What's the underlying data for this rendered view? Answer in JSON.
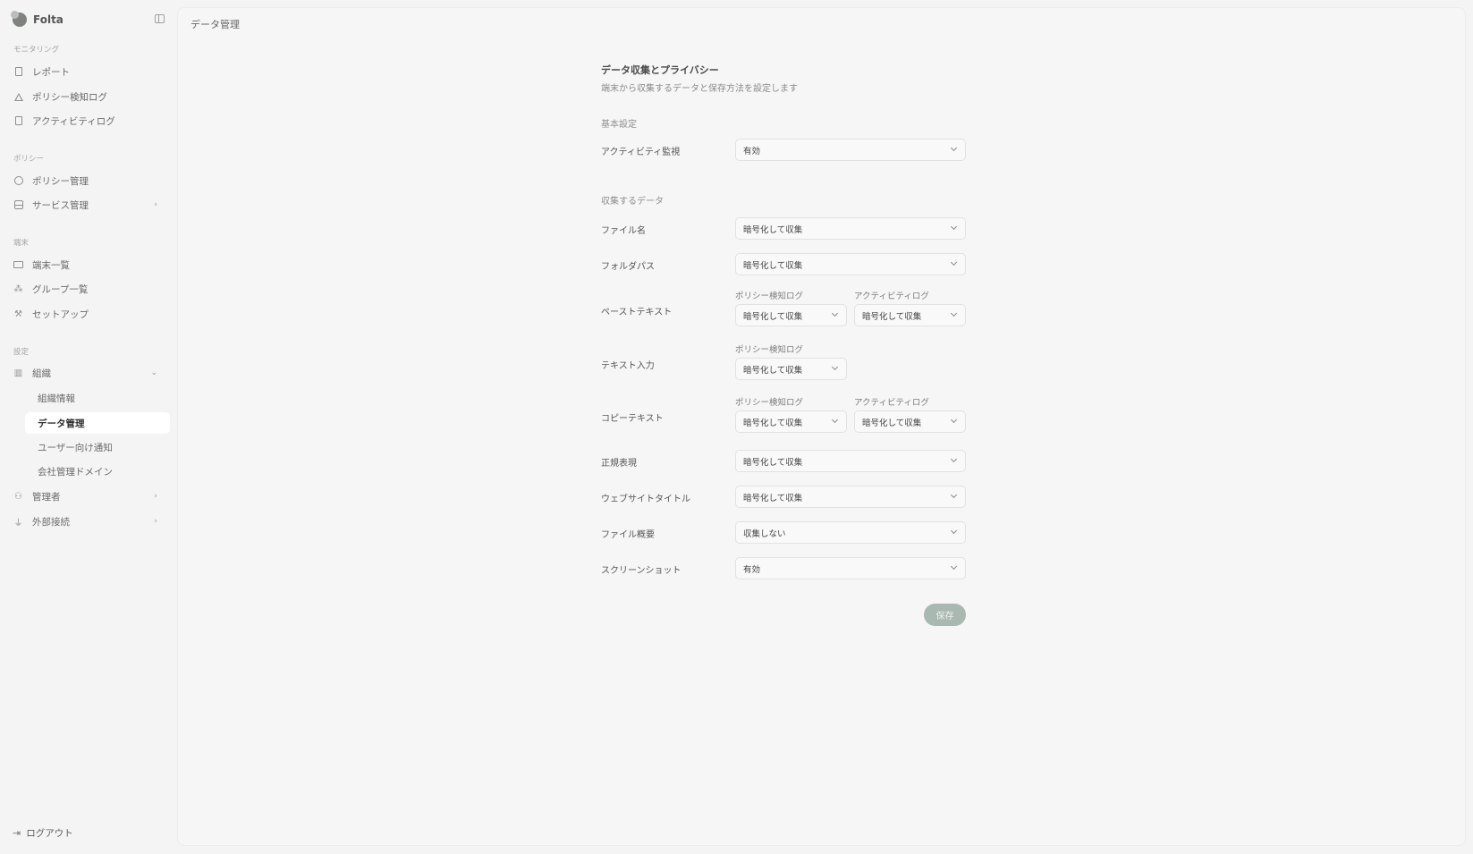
{
  "app": {
    "name": "Folta"
  },
  "sidebar": {
    "sections": [
      {
        "label": "モニタリング",
        "items": [
          "レポート",
          "ポリシー検知ログ",
          "アクティビティログ"
        ]
      },
      {
        "label": "ポリシー",
        "items": [
          "ポリシー管理",
          "サービス管理"
        ]
      },
      {
        "label": "端末",
        "items": [
          "端末一覧",
          "グループ一覧",
          "セットアップ"
        ]
      },
      {
        "label": "設定",
        "items": [
          "組織",
          "管理者",
          "外部接続"
        ]
      }
    ],
    "org_subitems": [
      "組織情報",
      "データ管理",
      "ユーザー向け通知",
      "会社管理ドメイン"
    ],
    "logout": "ログアウト"
  },
  "page": {
    "title": "データ管理"
  },
  "form": {
    "title": "データ収集とプライバシー",
    "subtitle": "端末から収集するデータと保存方法を設定します",
    "basic_label": "基本設定",
    "collect_label": "収集するデータ",
    "col_policy": "ポリシー検知ログ",
    "col_activity": "アクティビティログ",
    "rows": {
      "activity_monitor": {
        "label": "アクティビティ監視",
        "value": "有効"
      },
      "file_name": {
        "label": "ファイル名",
        "value": "暗号化して収集"
      },
      "folder_path": {
        "label": "フォルダパス",
        "value": "暗号化して収集"
      },
      "paste_text": {
        "label": "ペーストテキスト",
        "policy": "暗号化して収集",
        "activity": "暗号化して収集"
      },
      "text_input": {
        "label": "テキスト入力",
        "policy": "暗号化して収集"
      },
      "copy_text": {
        "label": "コピーテキスト",
        "policy": "暗号化して収集",
        "activity": "暗号化して収集"
      },
      "regex": {
        "label": "正規表現",
        "value": "暗号化して収集"
      },
      "website_title": {
        "label": "ウェブサイトタイトル",
        "value": "暗号化して収集"
      },
      "file_summary": {
        "label": "ファイル概要",
        "value": "収集しない"
      },
      "screenshot": {
        "label": "スクリーンショット",
        "value": "有効"
      }
    },
    "save": "保存"
  },
  "colors": {
    "accent": "#a9b8b1",
    "active_bg": "#ffffff"
  }
}
